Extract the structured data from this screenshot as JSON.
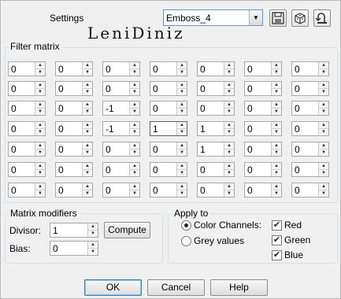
{
  "header": {
    "settings_label": "Settings",
    "preset_value": "Emboss_4",
    "watermark": "LeniDiniz"
  },
  "matrix": {
    "title": "Filter matrix",
    "rows": [
      [
        "0",
        "0",
        "0",
        "0",
        "0",
        "0",
        "0"
      ],
      [
        "0",
        "0",
        "0",
        "0",
        "0",
        "0",
        "0"
      ],
      [
        "0",
        "0",
        "-1",
        "0",
        "0",
        "0",
        "0"
      ],
      [
        "0",
        "0",
        "-1",
        "1",
        "1",
        "0",
        "0"
      ],
      [
        "0",
        "0",
        "0",
        "0",
        "1",
        "0",
        "0"
      ],
      [
        "0",
        "0",
        "0",
        "0",
        "0",
        "0",
        "0"
      ],
      [
        "0",
        "0",
        "0",
        "0",
        "0",
        "0",
        "0"
      ]
    ]
  },
  "modifiers": {
    "title": "Matrix modifiers",
    "divisor_label": "Divisor:",
    "divisor_value": "1",
    "compute_label": "Compute",
    "bias_label": "Bias:",
    "bias_value": "0"
  },
  "apply_to": {
    "title": "Apply to",
    "color_channels_label": "Color Channels:",
    "grey_values_label": "Grey values",
    "red_label": "Red",
    "green_label": "Green",
    "blue_label": "Blue"
  },
  "footer": {
    "ok_label": "OK",
    "cancel_label": "Cancel",
    "help_label": "Help"
  },
  "icons": [
    "save-preset-icon",
    "randomize-icon",
    "reset-icon",
    "spin-up-icon",
    "spin-down-icon",
    "dropdown-arrow-icon",
    "checkmark-icon"
  ]
}
